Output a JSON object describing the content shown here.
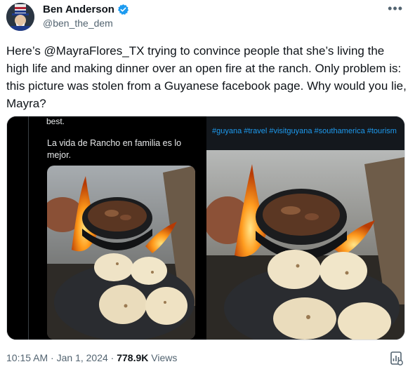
{
  "author": {
    "name": "Ben Anderson",
    "handle": "@ben_the_dem",
    "verified_icon": "verified-badge-icon",
    "avatar_icon": "uncle-sam-avatar"
  },
  "more_label": "•••",
  "tweet_text": "Here’s @MayraFlores_TX trying to convince people that she’s living the high life and making dinner over an open fire at the ranch. Only problem is: this picture was stolen from a Guyanese facebook page. Why would you lie, Mayra?",
  "media": {
    "left": {
      "caption_top": "best.",
      "caption": "La vida de Rancho en familia es lo mejor."
    },
    "right": {
      "hashtags": "#guyana #travel #visitguyana #southamerica #tourism"
    }
  },
  "meta": {
    "time": "10:15 AM",
    "separator": " · ",
    "date": "Jan 1, 2024",
    "views_count": "778.9K",
    "views_label": "Views"
  },
  "colors": {
    "accent": "#1d9bf0",
    "muted": "#536471"
  }
}
